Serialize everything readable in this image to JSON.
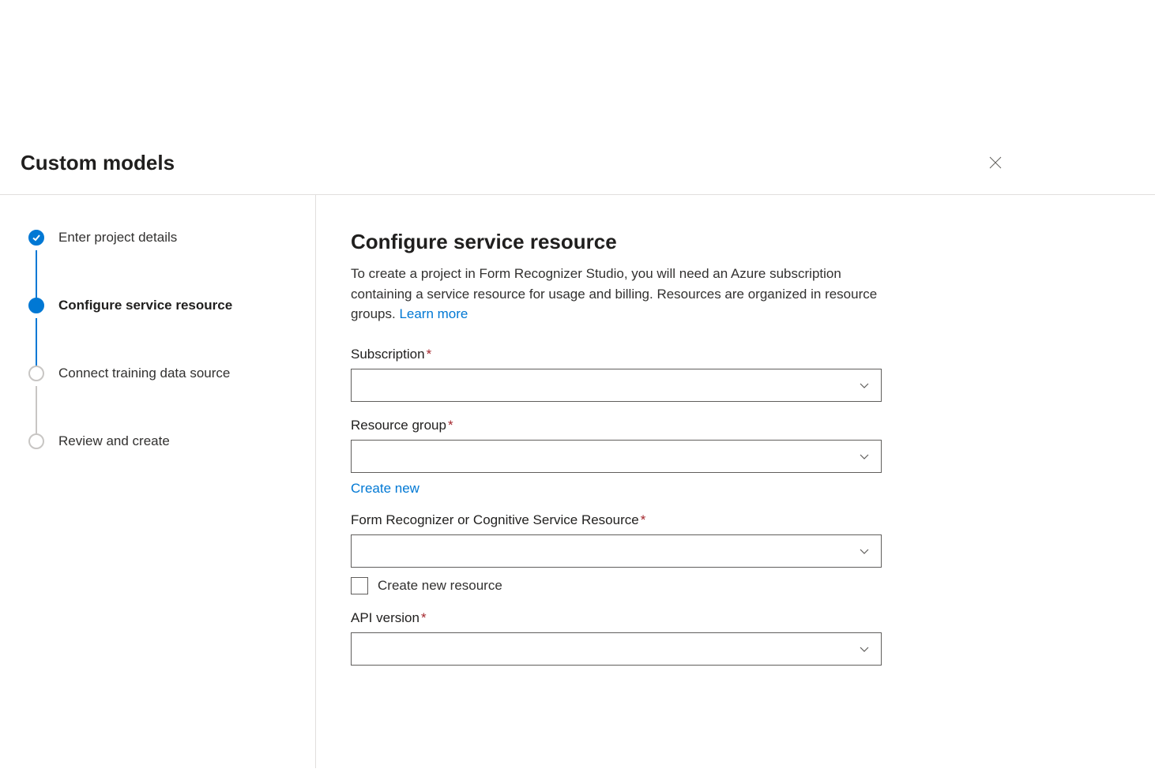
{
  "header": {
    "title": "Custom models"
  },
  "steps": [
    {
      "label": "Enter project details",
      "state": "completed"
    },
    {
      "label": "Configure service resource",
      "state": "current"
    },
    {
      "label": "Connect training data source",
      "state": "upcoming"
    },
    {
      "label": "Review and create",
      "state": "upcoming"
    }
  ],
  "main": {
    "heading": "Configure service resource",
    "description_pre": "To create a project in Form Recognizer Studio, you will need an Azure subscription containing a service resource for usage and billing. Resources are organized in resource groups. ",
    "learn_more": "Learn more",
    "fields": {
      "subscription": {
        "label": "Subscription",
        "required": true
      },
      "resource_group": {
        "label": "Resource group",
        "required": true,
        "create_new": "Create new"
      },
      "resource": {
        "label": "Form Recognizer or Cognitive Service Resource",
        "required": true,
        "checkbox_label": "Create new resource"
      },
      "api_version": {
        "label": "API version",
        "required": true
      }
    }
  }
}
